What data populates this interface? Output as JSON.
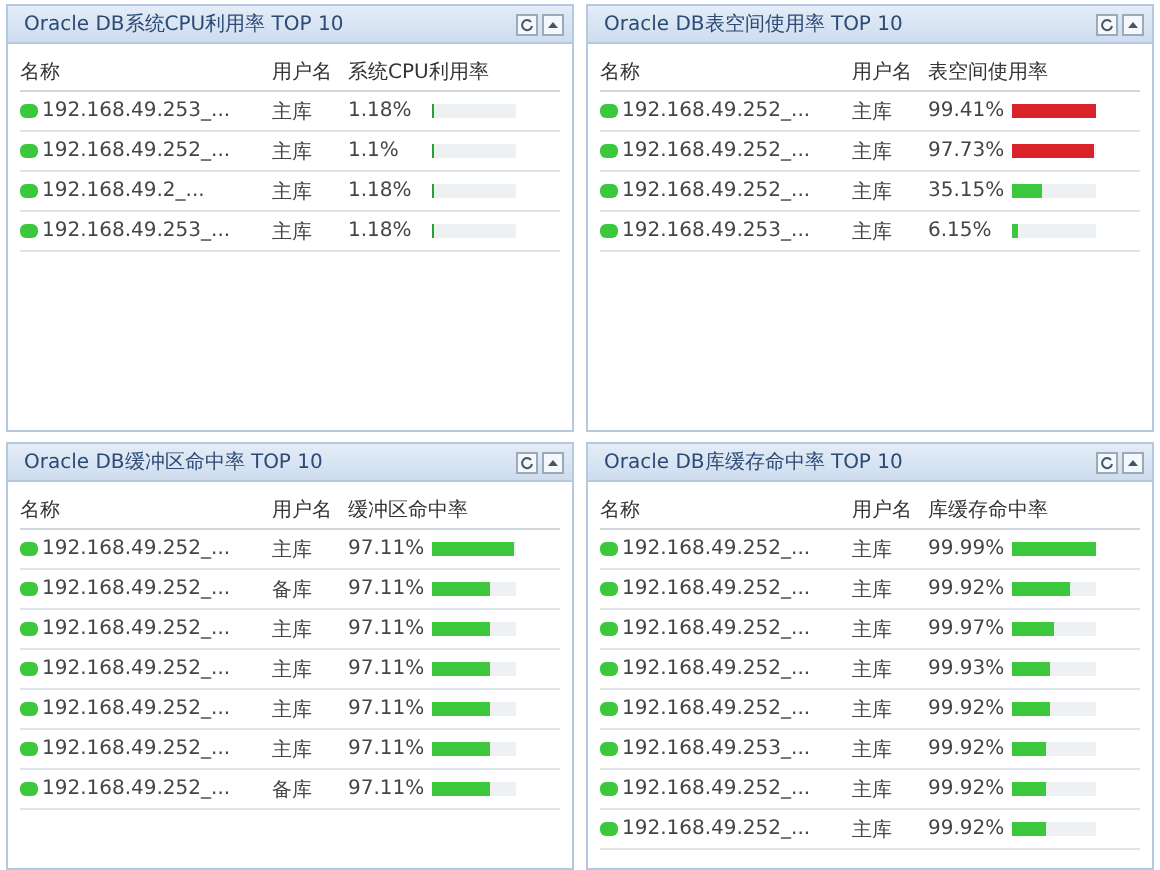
{
  "panels": [
    {
      "title": "Oracle DB系统CPU利用率 TOP 10",
      "columns": [
        "名称",
        "用户名",
        "系统CPU利用率"
      ],
      "rows": [
        {
          "name": "192.168.49.253_...",
          "user": "主库",
          "value": "1.18%",
          "level": 0.03,
          "color": "#2ca02c"
        },
        {
          "name": "192.168.49.252_...",
          "user": "主库",
          "value": "1.1%",
          "level": 0.03,
          "color": "#2ca02c"
        },
        {
          "name": "192.168.49.2_...",
          "user": "主库",
          "value": "1.18%",
          "level": 0.03,
          "color": "#2ca02c"
        },
        {
          "name": "192.168.49.253_...",
          "user": "主库",
          "value": "1.18%",
          "level": 0.03,
          "color": "#2ca02c"
        }
      ]
    },
    {
      "title": "Oracle DB表空间使用率 TOP 10",
      "columns": [
        "名称",
        "用户名",
        "表空间使用率"
      ],
      "rows": [
        {
          "name": "192.168.49.252_...",
          "user": "主库",
          "value": "99.41%",
          "level": 0.99,
          "color": "#d9222a"
        },
        {
          "name": "192.168.49.252_...",
          "user": "主库",
          "value": "97.73%",
          "level": 0.98,
          "color": "#d9222a"
        },
        {
          "name": "192.168.49.252_...",
          "user": "主库",
          "value": "35.15%",
          "level": 0.35,
          "color": "#3cc83c"
        },
        {
          "name": "192.168.49.253_...",
          "user": "主库",
          "value": "6.15%",
          "level": 0.06,
          "color": "#3cc83c"
        }
      ]
    },
    {
      "title": "Oracle DB缓冲区命中率 TOP 10",
      "columns": [
        "名称",
        "用户名",
        "缓冲区命中率"
      ],
      "rows": [
        {
          "name": "192.168.49.252_...",
          "user": "主库",
          "value": "97.11%",
          "level": 0.97,
          "color": "#3cc83c"
        },
        {
          "name": "192.168.49.252_...",
          "user": "备库",
          "value": "97.11%",
          "level": 0.7,
          "color": "#3cc83c"
        },
        {
          "name": "192.168.49.252_...",
          "user": "主库",
          "value": "97.11%",
          "level": 0.7,
          "color": "#3cc83c"
        },
        {
          "name": "192.168.49.252_...",
          "user": "主库",
          "value": "97.11%",
          "level": 0.7,
          "color": "#3cc83c"
        },
        {
          "name": "192.168.49.252_...",
          "user": "主库",
          "value": "97.11%",
          "level": 0.7,
          "color": "#3cc83c"
        },
        {
          "name": "192.168.49.252_...",
          "user": "主库",
          "value": "97.11%",
          "level": 0.7,
          "color": "#3cc83c"
        },
        {
          "name": "192.168.49.252_...",
          "user": "备库",
          "value": "97.11%",
          "level": 0.7,
          "color": "#3cc83c"
        }
      ]
    },
    {
      "title": "Oracle DB库缓存命中率 TOP 10",
      "columns": [
        "名称",
        "用户名",
        "库缓存命中率"
      ],
      "rows": [
        {
          "name": "192.168.49.252_...",
          "user": "主库",
          "value": "99.99%",
          "level": 1.0,
          "color": "#3cc83c"
        },
        {
          "name": "192.168.49.252_...",
          "user": "主库",
          "value": "99.92%",
          "level": 0.7,
          "color": "#3cc83c"
        },
        {
          "name": "192.168.49.252_...",
          "user": "主库",
          "value": "99.97%",
          "level": 0.5,
          "color": "#3cc83c"
        },
        {
          "name": "192.168.49.252_...",
          "user": "主库",
          "value": "99.93%",
          "level": 0.45,
          "color": "#3cc83c"
        },
        {
          "name": "192.168.49.252_...",
          "user": "主库",
          "value": "99.92%",
          "level": 0.45,
          "color": "#3cc83c"
        },
        {
          "name": "192.168.49.253_...",
          "user": "主库",
          "value": "99.92%",
          "level": 0.4,
          "color": "#3cc83c"
        },
        {
          "name": "192.168.49.252_...",
          "user": "主库",
          "value": "99.92%",
          "level": 0.4,
          "color": "#3cc83c"
        },
        {
          "name": "192.168.49.252_...",
          "user": "主库",
          "value": "99.92%",
          "level": 0.4,
          "color": "#3cc83c"
        }
      ]
    }
  ]
}
